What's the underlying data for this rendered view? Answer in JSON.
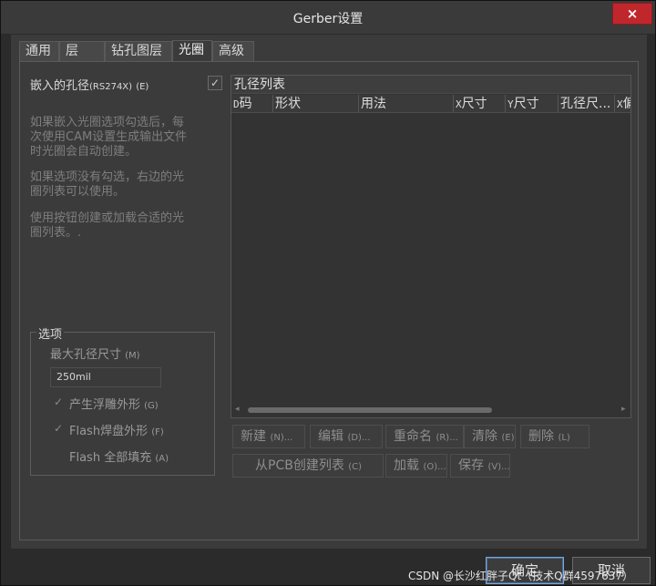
{
  "window": {
    "title": "Gerber设置",
    "close": "×"
  },
  "tabs": [
    "通用",
    "层",
    "钻孔图层",
    "光圈",
    "高级"
  ],
  "left": {
    "embed_label": "嵌入的孔径",
    "embed_label_code": "(RS274X)",
    "embed_label_key": "(E)",
    "embed_checked": "✓",
    "desc1": [
      "如果嵌入光圈选项勾选后，每",
      "次使用CAM设置生成输出文件",
      "时光圈会自动创建。"
    ],
    "desc2": [
      "如果选项没有勾选，右边的光",
      "圈列表可以使用。"
    ],
    "desc3": [
      "使用按钮创建或加载合适的光",
      "圈列表。."
    ],
    "options_title": "选项",
    "max_size_label": "最大孔径尺寸",
    "max_size_key": "(M)",
    "max_size_value": "250mil",
    "opt1": "产生浮雕外形",
    "opt1_key": "(G)",
    "opt2": "Flash焊盘外形",
    "opt2_key": "(F)",
    "opt3": "Flash 全部填充",
    "opt3_key": "(A)",
    "check": "✓"
  },
  "list": {
    "title": "孔径列表",
    "columns": [
      {
        "a": "D",
        "b": "码"
      },
      {
        "a": "",
        "b": "形状"
      },
      {
        "a": "",
        "b": "用法"
      },
      {
        "a": "X",
        "b": "尺寸"
      },
      {
        "a": "Y",
        "b": "尺寸"
      },
      {
        "a": "",
        "b": "孔径尺..."
      },
      {
        "a": "X",
        "b": "偏"
      }
    ],
    "arrow_left": "◂",
    "arrow_right": "▸"
  },
  "buttons": {
    "new": "新建",
    "new_key": "(N)...",
    "edit": "编辑",
    "edit_key": "(D)...",
    "rename": "重命名",
    "rename_key": "(R)...",
    "delete": "清除",
    "delete_key": "(E)",
    "remove": "删除",
    "remove_key": "(L)",
    "from_pcb": "从PCB创建列表",
    "from_pcb_key": "(C)",
    "load": "加载",
    "load_key": "(O)...",
    "save": "保存",
    "save_key": "(V)..."
  },
  "footer": {
    "ok": "确定",
    "cancel": "取消"
  },
  "watermark": "CSDN @长沙红胖子Qt（技术Q群4597637）"
}
